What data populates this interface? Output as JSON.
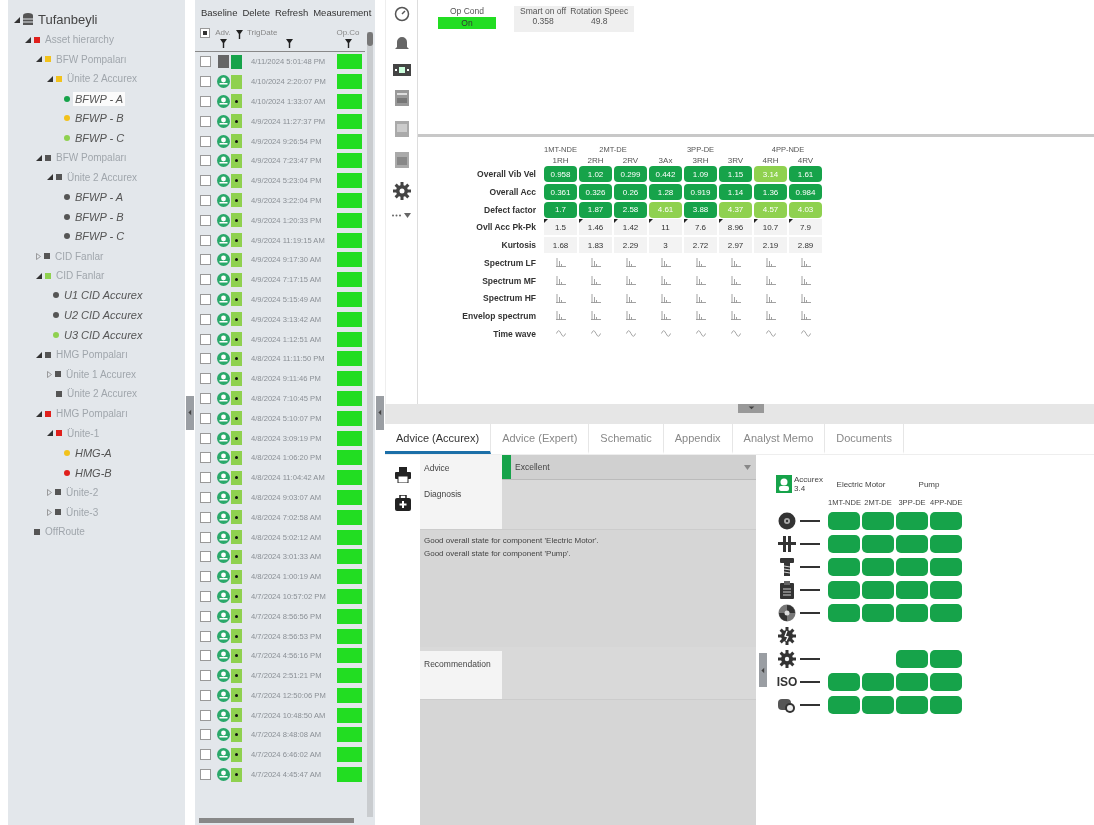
{
  "tree": {
    "label": "Tufanbeyli",
    "kind": "root",
    "expanded": true,
    "selected": false,
    "children": [
      {
        "label": "Asset hierarchy",
        "kind": "group",
        "expanded": true,
        "selected": false,
        "color": "#e0201c",
        "children": [
          {
            "label": "BFW Pompaları",
            "kind": "group",
            "expanded": true,
            "selected": false,
            "color": "#f2c21b",
            "children": [
              {
                "label": "Ünite 2 Accurex",
                "kind": "group",
                "expanded": true,
                "selected": false,
                "color": "#f2c21b",
                "children": [
                  {
                    "label": "BFWP - A",
                    "kind": "asset",
                    "selected": true,
                    "color": "#16a34a"
                  },
                  {
                    "label": "BFWP - B",
                    "kind": "asset",
                    "selected": false,
                    "color": "#f2c21b"
                  },
                  {
                    "label": "BFWP - C",
                    "kind": "asset",
                    "selected": false,
                    "color": "#8fd14f"
                  }
                ]
              }
            ]
          },
          {
            "label": "BFW Pompaları",
            "kind": "group",
            "expanded": true,
            "selected": false,
            "color": "#555555",
            "children": [
              {
                "label": "Ünite 2 Accurex",
                "kind": "group",
                "expanded": true,
                "selected": false,
                "color": "#555555",
                "children": [
                  {
                    "label": "BFWP - A",
                    "kind": "asset",
                    "selected": false,
                    "color": "#555555"
                  },
                  {
                    "label": "BFWP - B",
                    "kind": "asset",
                    "selected": false,
                    "color": "#555555"
                  },
                  {
                    "label": "BFWP - C",
                    "kind": "asset",
                    "selected": false,
                    "color": "#555555"
                  }
                ]
              }
            ]
          },
          {
            "label": "CID Fanlar",
            "kind": "group",
            "expanded": false,
            "selected": false,
            "color": "#555555"
          },
          {
            "label": "CID Fanlar",
            "kind": "group",
            "expanded": true,
            "selected": false,
            "color": "#8fd14f",
            "children": [
              {
                "label": "U1 CID Accurex",
                "kind": "asset",
                "selected": false,
                "color": "#555555"
              },
              {
                "label": "U2 CID Accurex",
                "kind": "asset",
                "selected": false,
                "color": "#555555"
              },
              {
                "label": "U3 CID Accurex",
                "kind": "asset",
                "selected": false,
                "color": "#8fd14f"
              }
            ]
          },
          {
            "label": "HMG Pompaları",
            "kind": "group",
            "expanded": true,
            "selected": false,
            "color": "#555555",
            "children": [
              {
                "label": "Ünite 1 Accurex",
                "kind": "group",
                "expanded": false,
                "selected": false,
                "color": "#555555"
              },
              {
                "label": "Ünite 2 Accurex",
                "kind": "node",
                "selected": false,
                "color": "#555555"
              }
            ]
          },
          {
            "label": "HMG Pompaları",
            "kind": "group",
            "expanded": true,
            "selected": false,
            "color": "#e0201c",
            "children": [
              {
                "label": "Ünite-1",
                "kind": "group",
                "expanded": true,
                "selected": false,
                "color": "#e0201c",
                "children": [
                  {
                    "label": "HMG-A",
                    "kind": "asset",
                    "selected": false,
                    "color": "#f2c21b"
                  },
                  {
                    "label": "HMG-B",
                    "kind": "asset",
                    "selected": false,
                    "color": "#e0201c"
                  }
                ]
              },
              {
                "label": "Ünite-2",
                "kind": "group",
                "expanded": false,
                "selected": false,
                "color": "#555555"
              },
              {
                "label": "Ünite-3",
                "kind": "group",
                "expanded": false,
                "selected": false,
                "color": "#555555"
              }
            ]
          }
        ]
      },
      {
        "label": "OffRoute",
        "kind": "node",
        "selected": false,
        "color": "#555555"
      }
    ]
  },
  "measurement_list": {
    "select_all_partial": true,
    "toolbar": [
      "Baseline",
      "Delete",
      "Refresh",
      "Measurement"
    ],
    "columns": [
      "Adv.",
      "TrigDate",
      "Op.Co"
    ],
    "rows": [
      {
        "kind": "pending",
        "color": "#16a34a",
        "star": false,
        "checked": false,
        "date": "4/11/2024 5:01:48 PM"
      },
      {
        "kind": "accurex",
        "color": "#8fd14f",
        "star": false,
        "checked": false,
        "date": "4/10/2024 2:20:07 PM"
      },
      {
        "kind": "accurex",
        "color": "#8fd14f",
        "star": true,
        "checked": false,
        "date": "4/10/2024 1:33:07 AM"
      },
      {
        "kind": "accurex",
        "color": "#8fd14f",
        "star": true,
        "checked": false,
        "date": "4/9/2024 11:27:37 PM"
      },
      {
        "kind": "accurex",
        "color": "#8fd14f",
        "star": true,
        "checked": false,
        "date": "4/9/2024 9:26:54 PM"
      },
      {
        "kind": "accurex",
        "color": "#8fd14f",
        "star": true,
        "checked": false,
        "date": "4/9/2024 7:23:47 PM"
      },
      {
        "kind": "accurex",
        "color": "#8fd14f",
        "star": true,
        "checked": false,
        "date": "4/9/2024 5:23:04 PM"
      },
      {
        "kind": "accurex",
        "color": "#8fd14f",
        "star": true,
        "checked": false,
        "date": "4/9/2024 3:22:04 PM"
      },
      {
        "kind": "accurex",
        "color": "#8fd14f",
        "star": true,
        "checked": false,
        "date": "4/9/2024 1:20:33 PM"
      },
      {
        "kind": "accurex",
        "color": "#8fd14f",
        "star": true,
        "checked": false,
        "date": "4/9/2024 11:19:15 AM"
      },
      {
        "kind": "accurex",
        "color": "#8fd14f",
        "star": true,
        "checked": false,
        "date": "4/9/2024 9:17:30 AM"
      },
      {
        "kind": "accurex",
        "color": "#8fd14f",
        "star": true,
        "checked": false,
        "date": "4/9/2024 7:17:15 AM"
      },
      {
        "kind": "accurex",
        "color": "#8fd14f",
        "star": true,
        "checked": false,
        "date": "4/9/2024 5:15:49 AM"
      },
      {
        "kind": "accurex",
        "color": "#8fd14f",
        "star": true,
        "checked": false,
        "date": "4/9/2024 3:13:42 AM"
      },
      {
        "kind": "accurex",
        "color": "#8fd14f",
        "star": true,
        "checked": false,
        "date": "4/9/2024 1:12:51 AM"
      },
      {
        "kind": "accurex",
        "color": "#8fd14f",
        "star": true,
        "checked": false,
        "date": "4/8/2024 11:11:50 PM"
      },
      {
        "kind": "accurex",
        "color": "#8fd14f",
        "star": true,
        "checked": false,
        "date": "4/8/2024 9:11:46 PM"
      },
      {
        "kind": "accurex",
        "color": "#8fd14f",
        "star": true,
        "checked": false,
        "date": "4/8/2024 7:10:45 PM"
      },
      {
        "kind": "accurex",
        "color": "#8fd14f",
        "star": true,
        "checked": false,
        "date": "4/8/2024 5:10:07 PM"
      },
      {
        "kind": "accurex",
        "color": "#8fd14f",
        "star": true,
        "checked": false,
        "date": "4/8/2024 3:09:19 PM"
      },
      {
        "kind": "accurex",
        "color": "#8fd14f",
        "star": true,
        "checked": false,
        "date": "4/8/2024 1:06:20 PM"
      },
      {
        "kind": "accurex",
        "color": "#8fd14f",
        "star": true,
        "checked": false,
        "date": "4/8/2024 11:04:42 AM"
      },
      {
        "kind": "accurex",
        "color": "#8fd14f",
        "star": true,
        "checked": false,
        "date": "4/8/2024 9:03:07 AM"
      },
      {
        "kind": "accurex",
        "color": "#8fd14f",
        "star": true,
        "checked": false,
        "date": "4/8/2024 7:02:58 AM"
      },
      {
        "kind": "accurex",
        "color": "#8fd14f",
        "star": true,
        "checked": false,
        "date": "4/8/2024 5:02:12 AM"
      },
      {
        "kind": "accurex",
        "color": "#8fd14f",
        "star": true,
        "checked": false,
        "date": "4/8/2024 3:01:33 AM"
      },
      {
        "kind": "accurex",
        "color": "#8fd14f",
        "star": true,
        "checked": false,
        "date": "4/8/2024 1:00:19 AM"
      },
      {
        "kind": "accurex",
        "color": "#8fd14f",
        "star": true,
        "checked": false,
        "date": "4/7/2024 10:57:02 PM"
      },
      {
        "kind": "accurex",
        "color": "#8fd14f",
        "star": true,
        "checked": false,
        "date": "4/7/2024 8:56:56 PM"
      },
      {
        "kind": "accurex",
        "color": "#8fd14f",
        "star": true,
        "checked": false,
        "date": "4/7/2024 8:56:53 PM"
      },
      {
        "kind": "accurex",
        "color": "#8fd14f",
        "star": true,
        "checked": false,
        "date": "4/7/2024 4:56:16 PM"
      },
      {
        "kind": "accurex",
        "color": "#8fd14f",
        "star": true,
        "checked": false,
        "date": "4/7/2024 2:51:21 PM"
      },
      {
        "kind": "accurex",
        "color": "#8fd14f",
        "star": true,
        "checked": false,
        "date": "4/7/2024 12:50:06 PM"
      },
      {
        "kind": "accurex",
        "color": "#8fd14f",
        "star": true,
        "checked": false,
        "date": "4/7/2024 10:48:50 AM"
      },
      {
        "kind": "accurex",
        "color": "#8fd14f",
        "star": true,
        "checked": false,
        "date": "4/7/2024 8:48:08 AM"
      },
      {
        "kind": "accurex",
        "color": "#8fd14f",
        "star": true,
        "checked": false,
        "date": "4/7/2024 6:46:02 AM"
      },
      {
        "kind": "accurex",
        "color": "#8fd14f",
        "star": true,
        "checked": false,
        "date": "4/7/2024 4:45:47 AM"
      }
    ]
  },
  "op_values": {
    "op_cond": {
      "label": "Op Cond",
      "value": "On"
    },
    "readings": [
      {
        "label": "Smart on off",
        "value": "0.358"
      },
      {
        "label": "Rotation Speec",
        "value": "49.8"
      }
    ]
  },
  "measurements": {
    "groups": [
      {
        "label": "1MT-NDE",
        "channels": [
          "1RH"
        ]
      },
      {
        "label": "2MT-DE",
        "channels": [
          "2RH",
          "2RV"
        ]
      },
      {
        "label": "3PP-DE",
        "channels": [
          "3Ax",
          "3RH",
          "3RV"
        ]
      },
      {
        "label": "4PP-NDE",
        "channels": [
          "4RH",
          "4RV"
        ]
      }
    ],
    "rows": [
      {
        "label": "Overall Vib Vel",
        "kind": "status",
        "cells": [
          {
            "value": "0.958",
            "color": "#16a34a"
          },
          {
            "value": "1.02",
            "color": "#16a34a"
          },
          {
            "value": "0.299",
            "color": "#16a34a"
          },
          {
            "value": "0.442",
            "color": "#16a34a"
          },
          {
            "value": "1.09",
            "color": "#16a34a"
          },
          {
            "value": "1.15",
            "color": "#16a34a"
          },
          {
            "value": "3.14",
            "color": "#8fd14f"
          },
          {
            "value": "1.61",
            "color": "#16a34a"
          }
        ]
      },
      {
        "label": "Overall Acc",
        "kind": "status",
        "cells": [
          {
            "value": "0.361",
            "color": "#16a34a"
          },
          {
            "value": "0.326",
            "color": "#16a34a"
          },
          {
            "value": "0.26",
            "color": "#16a34a"
          },
          {
            "value": "1.28",
            "color": "#16a34a"
          },
          {
            "value": "0.919",
            "color": "#16a34a"
          },
          {
            "value": "1.14",
            "color": "#16a34a"
          },
          {
            "value": "1.36",
            "color": "#16a34a"
          },
          {
            "value": "0.984",
            "color": "#16a34a"
          }
        ]
      },
      {
        "label": "Defect factor",
        "kind": "status",
        "cells": [
          {
            "value": "1.7",
            "color": "#16a34a"
          },
          {
            "value": "1.87",
            "color": "#16a34a"
          },
          {
            "value": "2.58",
            "color": "#16a34a"
          },
          {
            "value": "4.61",
            "color": "#8fd14f"
          },
          {
            "value": "3.88",
            "color": "#16a34a"
          },
          {
            "value": "4.37",
            "color": "#8fd14f"
          },
          {
            "value": "4.57",
            "color": "#8fd14f"
          },
          {
            "value": "4.03",
            "color": "#8fd14f"
          }
        ]
      },
      {
        "label": "Ovll Acc Pk-Pk",
        "kind": "flagged",
        "cells": [
          {
            "value": "1.5"
          },
          {
            "value": "1.46"
          },
          {
            "value": "1.42"
          },
          {
            "value": "11"
          },
          {
            "value": "7.6"
          },
          {
            "value": "8.96"
          },
          {
            "value": "10.7"
          },
          {
            "value": "7.9"
          }
        ]
      },
      {
        "label": "Kurtosis",
        "kind": "value",
        "cells": [
          {
            "value": "1.68"
          },
          {
            "value": "1.83"
          },
          {
            "value": "2.29"
          },
          {
            "value": "3"
          },
          {
            "value": "2.72"
          },
          {
            "value": "2.97"
          },
          {
            "value": "2.19"
          },
          {
            "value": "2.89"
          }
        ]
      },
      {
        "label": "Spectrum LF",
        "kind": "spectrum"
      },
      {
        "label": "Spectrum MF",
        "kind": "spectrum"
      },
      {
        "label": "Spectrum HF",
        "kind": "spectrum"
      },
      {
        "label": "Envelop spectrum",
        "kind": "spectrum"
      },
      {
        "label": "Time wave",
        "kind": "wave"
      }
    ]
  },
  "tabs": [
    {
      "label": "Advice (Accurex)",
      "selected": true
    },
    {
      "label": "Advice (Expert)",
      "selected": false
    },
    {
      "label": "Schematic",
      "selected": false
    },
    {
      "label": "Appendix",
      "selected": false
    },
    {
      "label": "Analyst Memo",
      "selected": false
    },
    {
      "label": "Documents",
      "selected": false
    }
  ],
  "advice": {
    "label": "Advice",
    "value": "Excellent",
    "color": "#16a34a",
    "diagnosis_label": "Diagnosis",
    "diagnosis": [
      "Good overall state for component 'Electric Motor'.",
      "Good overall state for component 'Pump'."
    ],
    "recommendation_label": "Recommendation"
  },
  "summary": {
    "engine": {
      "name": "Accurex",
      "version": "3.4"
    },
    "components": [
      {
        "label": "Electric Motor",
        "channels": [
          "1MT-NDE",
          "2MT-DE"
        ]
      },
      {
        "label": "Pump",
        "channels": [
          "3PP-DE",
          "4PP-NDE"
        ]
      }
    ],
    "rows": [
      {
        "kind": "disc",
        "cells": [
          {
            "on": true
          },
          {
            "on": true
          },
          {
            "on": true
          },
          {
            "on": true
          }
        ]
      },
      {
        "kind": "coupling",
        "cells": [
          {
            "on": true
          },
          {
            "on": true
          },
          {
            "on": true
          },
          {
            "on": true
          }
        ]
      },
      {
        "kind": "bolt",
        "cells": [
          {
            "on": true
          },
          {
            "on": true
          },
          {
            "on": true
          },
          {
            "on": true
          }
        ]
      },
      {
        "kind": "clipboard",
        "cells": [
          {
            "on": true
          },
          {
            "on": true
          },
          {
            "on": true
          },
          {
            "on": true
          }
        ]
      },
      {
        "kind": "fan",
        "cells": [
          {
            "on": true
          },
          {
            "on": true
          },
          {
            "on": true
          },
          {
            "on": true
          }
        ]
      },
      {
        "kind": "broken_gear",
        "cells": [
          {
            "on": false
          },
          {
            "on": false
          },
          {
            "on": false
          },
          {
            "on": false
          }
        ]
      },
      {
        "kind": "gear",
        "cells": [
          {
            "on": false
          },
          {
            "on": false
          },
          {
            "on": true
          },
          {
            "on": true
          }
        ]
      },
      {
        "kind": "iso",
        "label": "ISO",
        "cells": [
          {
            "on": true
          },
          {
            "on": true
          },
          {
            "on": true
          },
          {
            "on": true
          }
        ]
      },
      {
        "kind": "motor",
        "cells": [
          {
            "on": true
          },
          {
            "on": true
          },
          {
            "on": true
          },
          {
            "on": true
          }
        ]
      }
    ]
  }
}
